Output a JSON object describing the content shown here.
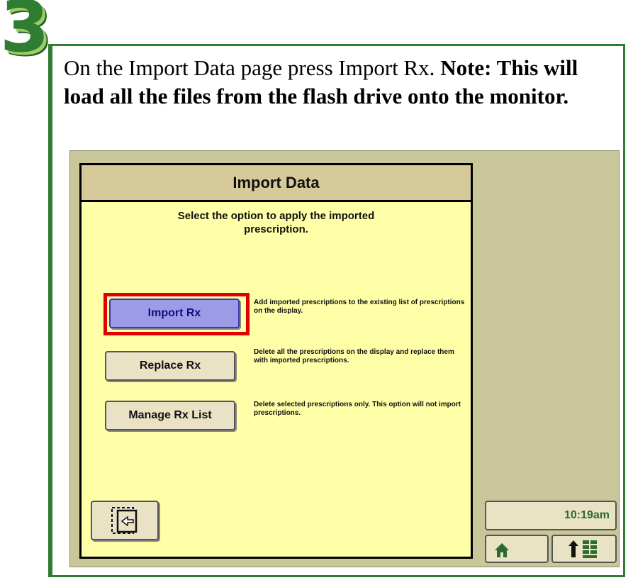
{
  "step": {
    "number": "3"
  },
  "instruction": {
    "text": "On the Import Data page press Import Rx. ",
    "note": "Note: This will load all the files from the flash drive onto the monitor."
  },
  "dialog": {
    "title": "Import Data",
    "subtitle": "Select the option to apply the imported\nprescription.",
    "options": [
      {
        "label": "Import Rx",
        "description": "Add imported prescriptions to the existing list of prescriptions on the display."
      },
      {
        "label": "Replace Rx",
        "description": "Delete all the prescriptions on the display and replace them with imported prescriptions."
      },
      {
        "label": "Manage Rx List",
        "description": "Delete selected prescriptions only.  This option will not import prescriptions."
      }
    ]
  },
  "status": {
    "time": "10:19am"
  },
  "icons": {
    "back": "exit-icon",
    "home": "home-icon",
    "menu": "menu-icon"
  },
  "colors": {
    "frame": "#2e7d32",
    "highlight": "#e00000",
    "panel": "#ffffa8",
    "header": "#d6ca9a",
    "active_button": "#9b9be8"
  }
}
